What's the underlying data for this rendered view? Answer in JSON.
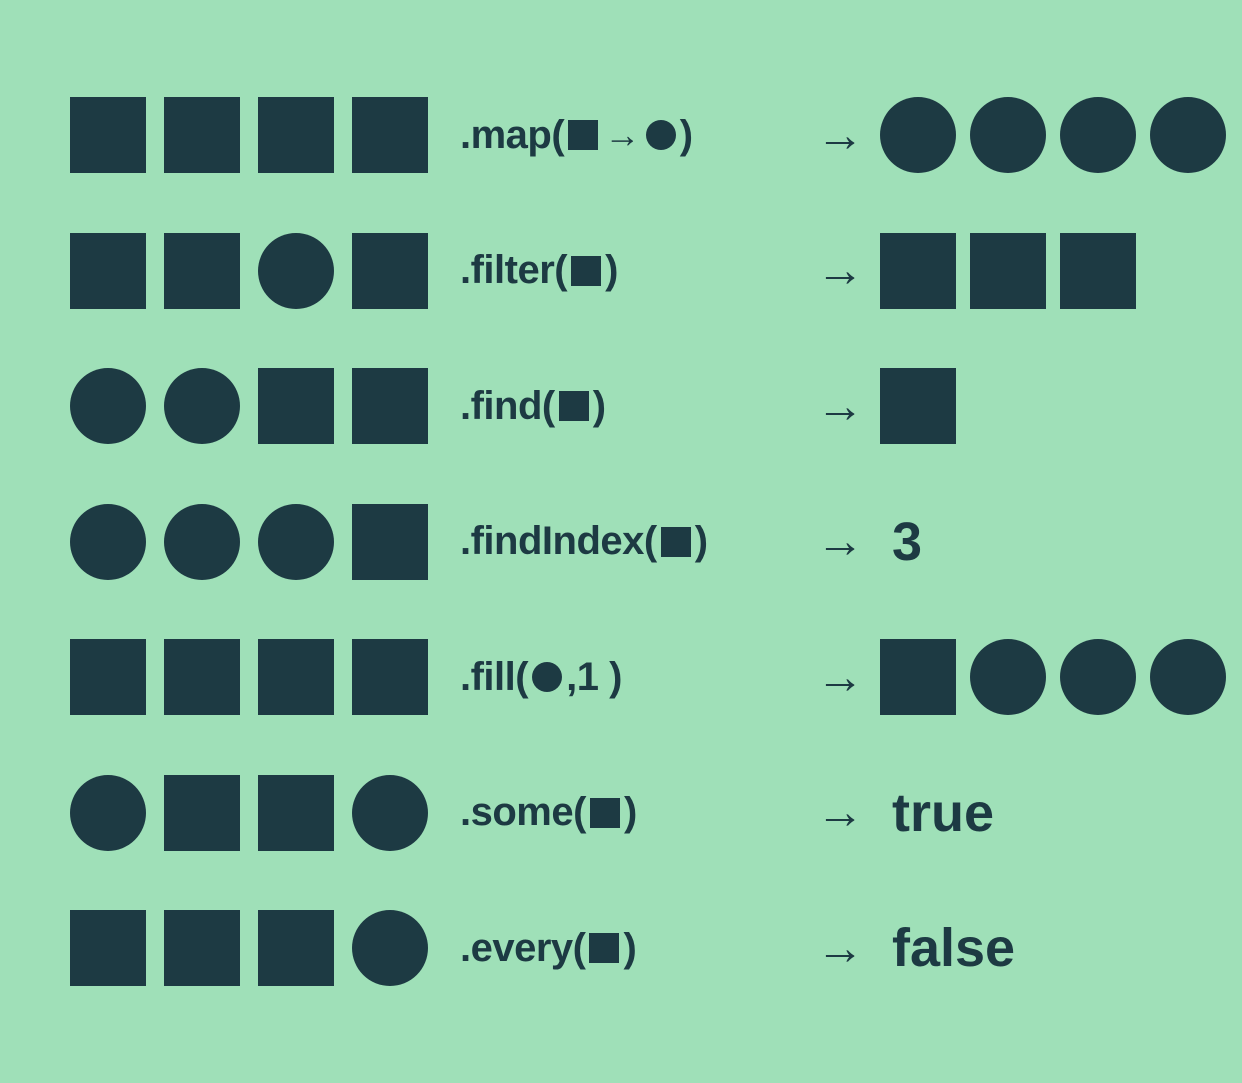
{
  "colors": {
    "background": "#9fe0b8",
    "foreground": "#1d3a43"
  },
  "arrow_glyph": "→",
  "rows": [
    {
      "input": [
        "square",
        "square",
        "square",
        "square"
      ],
      "method": {
        "pre": ".map(",
        "args": [
          "square",
          "arrow",
          "circle"
        ],
        "post": ")"
      },
      "output_shapes": [
        "circle",
        "circle",
        "circle",
        "circle"
      ],
      "output_text": null
    },
    {
      "input": [
        "square",
        "square",
        "circle",
        "square"
      ],
      "method": {
        "pre": ".filter(",
        "args": [
          "square"
        ],
        "post": ")"
      },
      "output_shapes": [
        "square",
        "square",
        "square"
      ],
      "output_text": null
    },
    {
      "input": [
        "circle",
        "circle",
        "square",
        "square"
      ],
      "method": {
        "pre": ".find(",
        "args": [
          "square"
        ],
        "post": ")"
      },
      "output_shapes": [
        "square"
      ],
      "output_text": null
    },
    {
      "input": [
        "circle",
        "circle",
        "circle",
        "square"
      ],
      "method": {
        "pre": ".findIndex(",
        "args": [
          "square"
        ],
        "post": ")"
      },
      "output_shapes": [],
      "output_text": "3"
    },
    {
      "input": [
        "square",
        "square",
        "square",
        "square"
      ],
      "method": {
        "pre": ".fill(",
        "args": [
          "circle"
        ],
        "post": ",1 )"
      },
      "output_shapes": [
        "square",
        "circle",
        "circle",
        "circle"
      ],
      "output_text": null
    },
    {
      "input": [
        "circle",
        "square",
        "square",
        "circle"
      ],
      "method": {
        "pre": ".some(",
        "args": [
          "square"
        ],
        "post": ")"
      },
      "output_shapes": [],
      "output_text": "true"
    },
    {
      "input": [
        "square",
        "square",
        "square",
        "circle"
      ],
      "method": {
        "pre": ".every(",
        "args": [
          "square"
        ],
        "post": ")"
      },
      "output_shapes": [],
      "output_text": "false"
    }
  ]
}
